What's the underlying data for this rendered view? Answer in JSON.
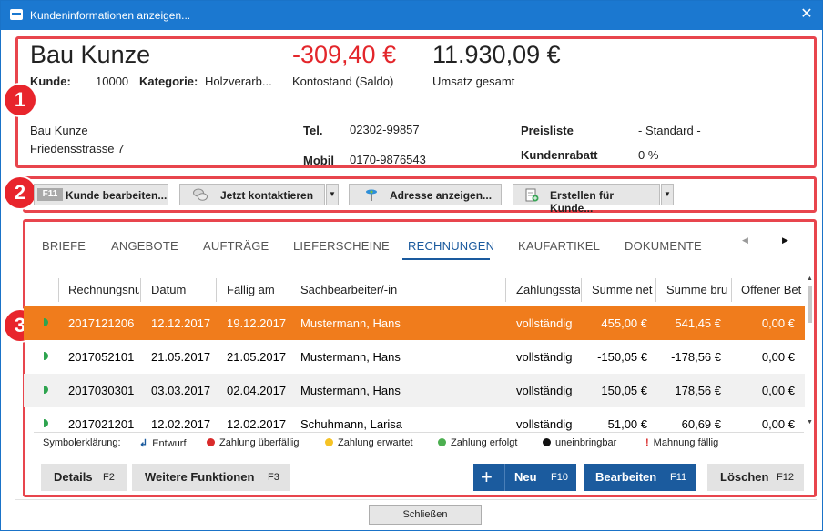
{
  "window": {
    "title": "Kundeninformationen anzeigen..."
  },
  "customer": {
    "name": "Bau Kunze",
    "balance": "-309,40 €",
    "balance_label": "Kontostand (Saldo)",
    "revenue": "11.930,09 €",
    "revenue_label": "Umsatz gesamt",
    "kunde_label": "Kunde:",
    "kunde_value": "10000",
    "kategorie_label": "Kategorie:",
    "kategorie_value": "Holzverarb...",
    "address_line1": "Bau Kunze",
    "address_line2": "Friedensstrasse 7",
    "tel_label": "Tel.",
    "tel_value": "02302-99857",
    "mobil_label": "Mobil",
    "mobil_value": "0170-9876543",
    "preisliste_label": "Preisliste",
    "preisliste_value": "- Standard -",
    "rabatt_label": "Kundenrabatt",
    "rabatt_value": "0 %"
  },
  "badges": [
    "1",
    "2",
    "3"
  ],
  "toolbar": {
    "edit_key": "F11",
    "edit_label": "Kunde bearbeiten...",
    "contact_label": "Jetzt kontaktieren",
    "address_label": "Adresse anzeigen...",
    "create_label": "Erstellen für Kunde..."
  },
  "tabs": [
    "BRIEFE",
    "ANGEBOTE",
    "AUFTRÄGE",
    "LIEFERSCHEINE",
    "RECHNUNGEN",
    "KAUFARTIKEL",
    "DOKUMENTE"
  ],
  "table": {
    "headers": [
      "Rechnungsnu",
      "Datum",
      "Fällig am",
      "Sachbearbeiter/-in",
      "Zahlungssta",
      "Summe net",
      "Summe bru",
      "Offener Bet"
    ],
    "rows": [
      [
        "2017121206",
        "12.12.2017",
        "19.12.2017",
        "Mustermann, Hans",
        "vollständig",
        "455,00 €",
        "541,45 €",
        "0,00 €"
      ],
      [
        "2017052101",
        "21.05.2017",
        "21.05.2017",
        "Mustermann, Hans",
        "vollständig",
        "-150,05 €",
        "-178,56 €",
        "0,00 €"
      ],
      [
        "2017030301",
        "03.03.2017",
        "02.04.2017",
        "Mustermann, Hans",
        "vollständig",
        "150,05 €",
        "178,56 €",
        "0,00 €"
      ],
      [
        "2017021201",
        "12.02.2017",
        "12.02.2017",
        "Schuhmann, Larisa",
        "vollständig",
        "51,00 €",
        "60,69 €",
        "0,00 €"
      ]
    ]
  },
  "legend": {
    "title": "Symbolerklärung:",
    "entwurf": "Entwurf",
    "ueberfaellig": "Zahlung überfällig",
    "erwartet": "Zahlung erwartet",
    "erfolgt": "Zahlung erfolgt",
    "uneinbringbar": "uneinbringbar",
    "mahnung": "Mahnung fällig"
  },
  "footer": {
    "details_label": "Details",
    "details_key": "F2",
    "weitere_label": "Weitere Funktionen",
    "weitere_key": "F3",
    "neu_label": "Neu",
    "neu_key": "F10",
    "bearbeiten_label": "Bearbeiten",
    "bearbeiten_key": "F11",
    "loeschen_label": "Löschen",
    "loeschen_key": "F12",
    "close_label": "Schließen"
  },
  "colors": {
    "titlebar": "#1b78d0",
    "negative": "#e3262b",
    "selected_row": "#f07c1c",
    "primary_button": "#1b5b9e",
    "annotation_red": "#e8454d"
  }
}
